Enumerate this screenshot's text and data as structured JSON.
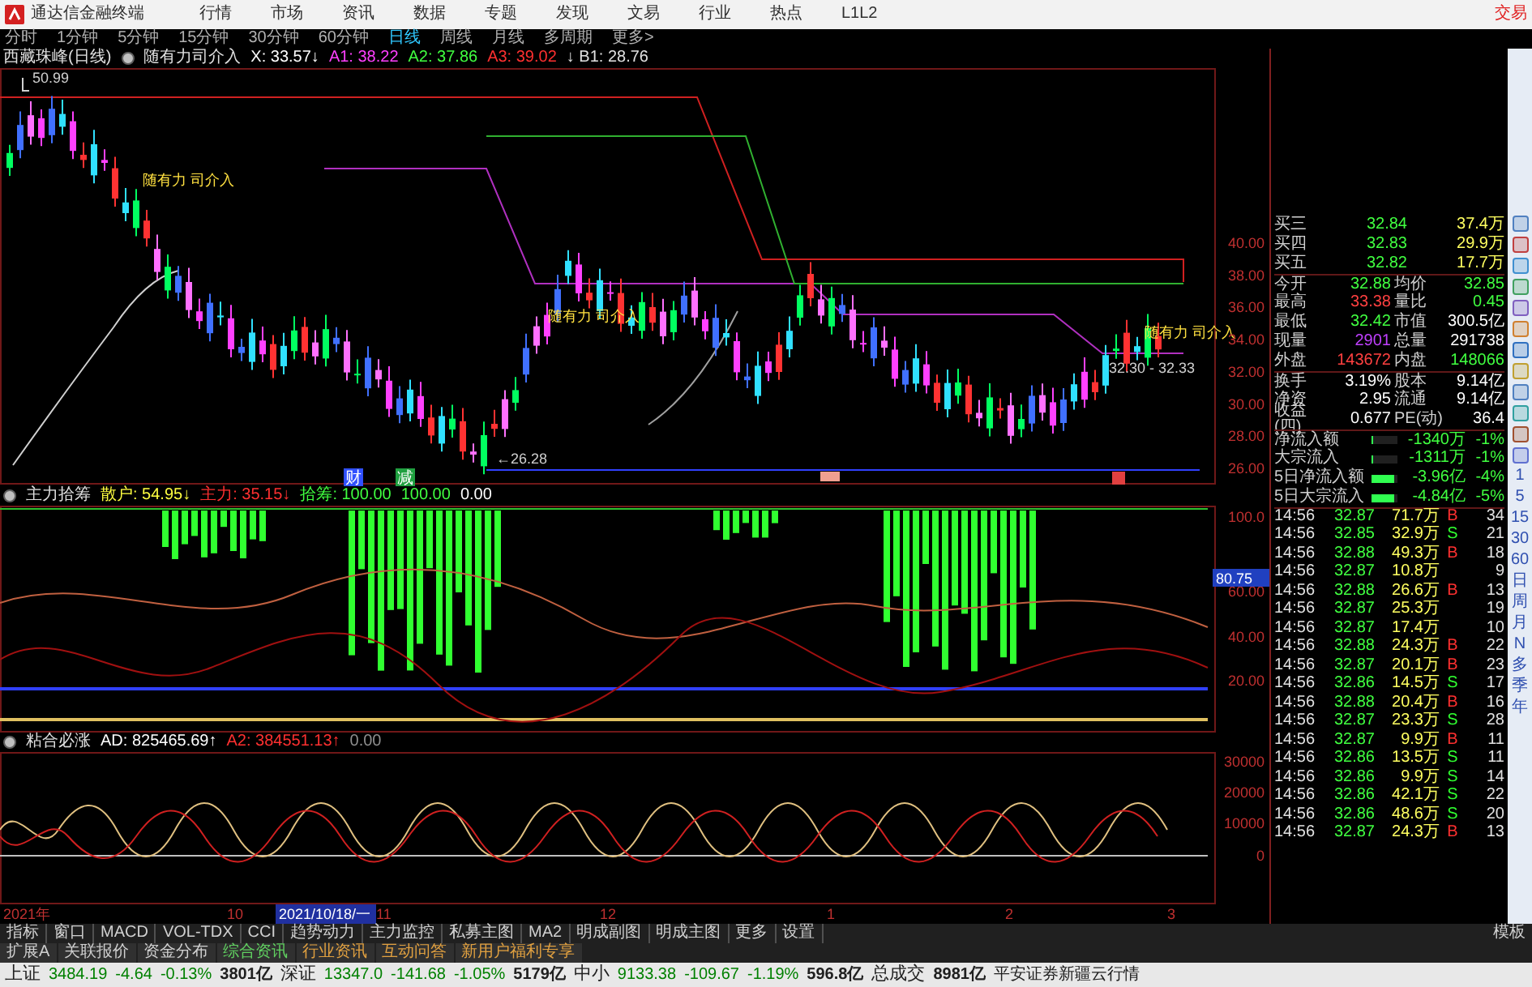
{
  "title_bar": {
    "app_name": "通达信金融终端",
    "menu": [
      "行情",
      "市场",
      "资讯",
      "数据",
      "专题",
      "发现",
      "文易",
      "行业",
      "热点",
      "L1L2"
    ],
    "trade_button": "交易"
  },
  "period_tabs": [
    {
      "label": "分时",
      "selected": false
    },
    {
      "label": "1分钟",
      "selected": false
    },
    {
      "label": "5分钟",
      "selected": false
    },
    {
      "label": "15分钟",
      "selected": false
    },
    {
      "label": "30分钟",
      "selected": false
    },
    {
      "label": "60分钟",
      "selected": false
    },
    {
      "label": "日线",
      "selected": true
    },
    {
      "label": "周线",
      "selected": false
    },
    {
      "label": "月线",
      "selected": false
    },
    {
      "label": "多周期",
      "selected": false
    },
    {
      "label": "更多>",
      "selected": false
    }
  ],
  "main_chart": {
    "stock": "西藏珠峰(日线)",
    "indicator": "随有力司介入",
    "readings": [
      {
        "text": "X: 33.57↓",
        "color": "#ffffff"
      },
      {
        "text": "A1: 38.22",
        "color": "#ff40ff"
      },
      {
        "text": "A2: 37.86",
        "color": "#40ff40"
      },
      {
        "text": "A3: 39.02",
        "color": "#ff3030"
      },
      {
        "text": "↓ B1: 28.76",
        "color": "#e0e0e0"
      }
    ],
    "price_axis": [
      "40.00",
      "38.00",
      "36.00",
      "34.00",
      "32.00",
      "30.00",
      "28.00",
      "26.00"
    ],
    "high_label": "50.99",
    "low_label": "←26.28",
    "range_label": "32.30 - 32.33",
    "signal_labels": [
      "随有力 司介入",
      "随有力 司介入",
      "随有力 司介入"
    ],
    "event_badges": [
      {
        "text": "财",
        "color": "#3050ff"
      },
      {
        "text": "减",
        "color": "#20a040"
      }
    ]
  },
  "indicator_panel": {
    "name": "主力拾筹",
    "readings": [
      {
        "text": "散户: 54.95↓",
        "color": "#ffff40"
      },
      {
        "text": "主力: 35.15↓",
        "color": "#ff3030"
      },
      {
        "text": "拾筹: 100.00",
        "color": "#40ff40"
      },
      {
        "text": "100.00",
        "color": "#40ff40"
      },
      {
        "text": "0.00",
        "color": "#ffffff"
      }
    ],
    "axis": [
      "100.0",
      "60.00",
      "40.00",
      "20.00"
    ],
    "cursor_value": "80.75"
  },
  "oscillator_panel": {
    "name": "粘合必涨",
    "readings": [
      {
        "text": "AD: 825465.69↑",
        "color": "#ffffff"
      },
      {
        "text": "A2: 384551.13↑",
        "color": "#ff3030"
      },
      {
        "text": "0.00",
        "color": "#909090"
      }
    ],
    "axis": [
      "30000",
      "20000",
      "10000",
      "0"
    ]
  },
  "date_axis": {
    "labels": [
      "2021年",
      "10",
      "11",
      "12",
      "1",
      "2",
      "3"
    ],
    "cursor_date": "2021/10/18/一"
  },
  "quote": {
    "order_book": [
      {
        "label": "买三",
        "price": "32.84",
        "volume": "37.4万"
      },
      {
        "label": "买四",
        "price": "32.83",
        "volume": "29.9万"
      },
      {
        "label": "买五",
        "price": "32.82",
        "volume": "17.7万"
      }
    ],
    "stats": [
      {
        "cells": [
          {
            "label": "今开",
            "value": "32.88",
            "color": "#40ff40"
          },
          {
            "label": "均价",
            "value": "32.85",
            "color": "#40ff40"
          }
        ]
      },
      {
        "cells": [
          {
            "label": "最高",
            "value": "33.38",
            "color": "#ff4040"
          },
          {
            "label": "量比",
            "value": "0.45",
            "color": "#40ff40"
          }
        ]
      },
      {
        "cells": [
          {
            "label": "最低",
            "value": "32.42",
            "color": "#40ff40"
          },
          {
            "label": "市值",
            "value": "300.5亿",
            "color": "#ffffff"
          }
        ]
      },
      {
        "cells": [
          {
            "label": "现量",
            "value": "2901",
            "color": "#c040ff"
          },
          {
            "label": "总量",
            "value": "291738",
            "color": "#ffffff"
          }
        ]
      },
      {
        "cells": [
          {
            "label": "外盘",
            "value": "143672",
            "color": "#ff4040"
          },
          {
            "label": "内盘",
            "value": "148066",
            "color": "#40ff40"
          }
        ]
      },
      {
        "cells": [
          {
            "label": "换手",
            "value": "3.19%",
            "color": "#ffffff"
          },
          {
            "label": "股本",
            "value": "9.14亿",
            "color": "#ffffff"
          }
        ]
      },
      {
        "cells": [
          {
            "label": "净资",
            "value": "2.95",
            "color": "#ffffff"
          },
          {
            "label": "流通",
            "value": "9.14亿",
            "color": "#ffffff"
          }
        ]
      },
      {
        "cells": [
          {
            "label": "收益(四)",
            "value": "0.677",
            "color": "#ffffff"
          },
          {
            "label": "PE(动)",
            "value": "36.4",
            "color": "#ffffff"
          }
        ]
      }
    ],
    "flows": [
      {
        "label": "净流入额",
        "level": 0.08,
        "value": "-1340万",
        "pct": "-1%"
      },
      {
        "label": "大宗流入",
        "level": 0.08,
        "value": "-1311万",
        "pct": "-1%"
      },
      {
        "label": "5日净流入额",
        "level": 0.85,
        "value": "-3.96亿",
        "pct": "-4%"
      },
      {
        "label": "5日大宗流入",
        "level": 0.85,
        "value": "-4.84亿",
        "pct": "-5%"
      }
    ],
    "ticks": [
      {
        "time": "14:56",
        "price": "32.87",
        "volume": "71.7万",
        "side": "B",
        "count": "34"
      },
      {
        "time": "14:56",
        "price": "32.85",
        "volume": "32.9万",
        "side": "S",
        "count": "21"
      },
      {
        "time": "14:56",
        "price": "32.88",
        "volume": "49.3万",
        "side": "B",
        "count": "18"
      },
      {
        "time": "14:56",
        "price": "32.87",
        "volume": "10.8万",
        "count": "9"
      },
      {
        "time": "14:56",
        "price": "32.88",
        "volume": "26.6万",
        "side": "B",
        "count": "13"
      },
      {
        "time": "14:56",
        "price": "32.87",
        "volume": "25.3万",
        "count": "19"
      },
      {
        "time": "14:56",
        "price": "32.87",
        "volume": "17.4万",
        "count": "10"
      },
      {
        "time": "14:56",
        "price": "32.88",
        "volume": "24.3万",
        "side": "B",
        "count": "22"
      },
      {
        "time": "14:56",
        "price": "32.87",
        "volume": "20.1万",
        "side": "B",
        "count": "23"
      },
      {
        "time": "14:56",
        "price": "32.86",
        "volume": "14.5万",
        "side": "S",
        "count": "17"
      },
      {
        "time": "14:56",
        "price": "32.88",
        "volume": "20.4万",
        "side": "B",
        "count": "16"
      },
      {
        "time": "14:56",
        "price": "32.87",
        "volume": "23.3万",
        "side": "S",
        "count": "28"
      },
      {
        "time": "14:56",
        "price": "32.87",
        "volume": "9.9万",
        "side": "B",
        "count": "11"
      },
      {
        "time": "14:56",
        "price": "32.86",
        "volume": "13.5万",
        "side": "S",
        "count": "11"
      },
      {
        "time": "14:56",
        "price": "32.86",
        "volume": "9.9万",
        "side": "S",
        "count": "14"
      },
      {
        "time": "14:56",
        "price": "32.86",
        "volume": "42.1万",
        "side": "S",
        "count": "22"
      },
      {
        "time": "14:56",
        "price": "32.86",
        "volume": "48.6万",
        "side": "S",
        "count": "20"
      },
      {
        "time": "14:56",
        "price": "32.87",
        "volume": "24.3万",
        "side": "B",
        "count": "13"
      }
    ]
  },
  "side_toolbar": {
    "periods": [
      "1",
      "5",
      "15",
      "30",
      "60",
      "日",
      "周",
      "月",
      "N",
      "多",
      "季",
      "年"
    ]
  },
  "bottom_tabs": [
    "指标",
    "窗口",
    "MACD",
    "VOL-TDX",
    "CCI",
    "趋势动力",
    "主力监控",
    "私募主图",
    "MA2",
    "明成副图",
    "明成主图",
    "更多",
    "设置"
  ],
  "template_button": "模板",
  "extension_tabs": [
    "扩展A",
    "关联报价",
    "资金分布",
    "综合资讯",
    "行业资讯",
    "互动问答",
    "新用户福利专享"
  ],
  "status_bar": {
    "indices": [
      {
        "name": "上证",
        "value": "3484.19",
        "change": "-4.64",
        "pct": "-0.13%",
        "amount": "3801亿"
      },
      {
        "name": "深证",
        "value": "13347.0",
        "change": "-141.68",
        "pct": "-1.05%",
        "amount": "5179亿"
      },
      {
        "name": "中小",
        "value": "9133.38",
        "change": "-109.67",
        "pct": "-1.19%",
        "amount": "596.8亿"
      }
    ],
    "total": {
      "label": "总成交",
      "value": "8981亿"
    },
    "broker": "平安证券新疆云行情"
  }
}
